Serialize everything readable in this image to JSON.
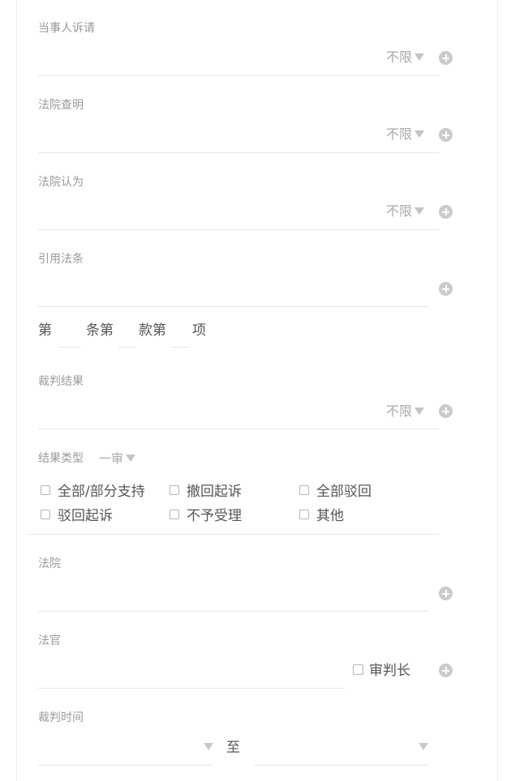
{
  "form": {
    "party_claims": {
      "label": "当事人诉请",
      "dropdown": "不限"
    },
    "court_finds": {
      "label": "法院查明",
      "dropdown": "不限"
    },
    "court_holds": {
      "label": "法院认为",
      "dropdown": "不限"
    },
    "cited_law": {
      "label": "引用法条",
      "parts": [
        "第",
        "条第",
        "款第",
        "项"
      ]
    },
    "judgment_result": {
      "label": "裁判结果",
      "dropdown": "不限"
    },
    "result_type": {
      "label": "结果类型",
      "dropdown": "一审",
      "options": [
        "全部/部分支持",
        "撤回起诉",
        "全部驳回",
        "驳回起诉",
        "不予受理",
        "其他"
      ]
    },
    "court": {
      "label": "法院"
    },
    "judge": {
      "label": "法官",
      "presiding_label": "审判长"
    },
    "judgment_time": {
      "label": "裁判时间",
      "to_label": "至"
    }
  }
}
